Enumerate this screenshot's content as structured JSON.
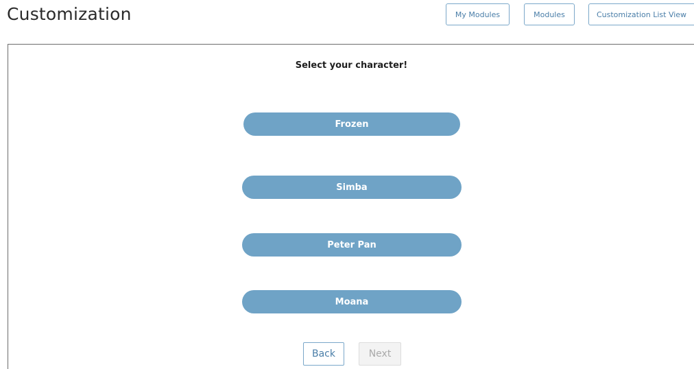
{
  "header": {
    "title": "Customization",
    "buttons": {
      "my_modules": "My Modules",
      "modules": "Modules",
      "customization_list_view": "Customization List View"
    }
  },
  "main": {
    "prompt": "Select your character!",
    "characters": [
      "Frozen",
      "Simba",
      "Peter Pan",
      "Moana"
    ],
    "navigation": {
      "back": "Back",
      "next": "Next",
      "next_disabled": true
    }
  },
  "colors": {
    "character_button_bg": "#6fa3c6",
    "outline_accent": "#7aa7c9"
  }
}
